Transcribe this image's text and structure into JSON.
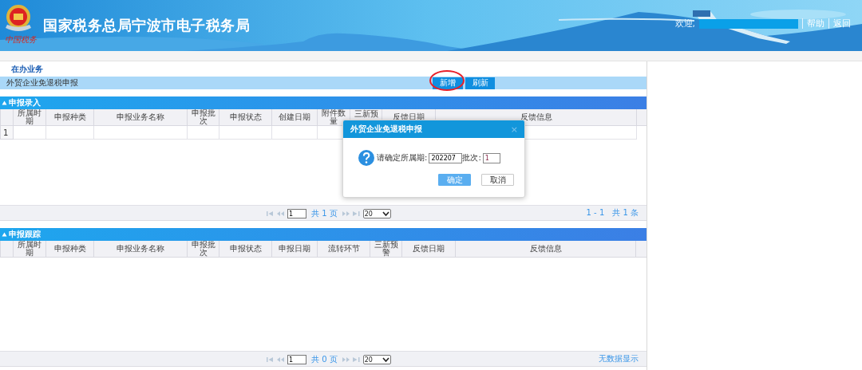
{
  "header": {
    "title": "国家税务总局宁波市电子税务局",
    "logo_caption": "中国税务",
    "welcome": "欢迎,",
    "links": [
      "帮助",
      "返回"
    ]
  },
  "breadcrumb": "在办业务",
  "toolbar": {
    "title": "外贸企业免退税申报",
    "buttons": [
      {
        "label": "新增",
        "highlighted": true
      },
      {
        "label": "刷新",
        "highlighted": false
      }
    ]
  },
  "panels": [
    {
      "title": "申报录入",
      "columns": [
        "所属时期",
        "申报种类",
        "申报业务名称",
        "申报批次",
        "申报状态",
        "创建日期",
        "附件数量",
        "三新预",
        "反馈日期",
        "反馈信息"
      ],
      "rows": [
        {
          "number": "1"
        }
      ],
      "pager": {
        "page": "1",
        "pages": "共 1 页",
        "page_size": "20",
        "summary": "1 - 1　共 1 条"
      }
    },
    {
      "title": "申报跟踪",
      "columns": [
        "所属时期",
        "申报种类",
        "申报业务名称",
        "申报批次",
        "申报状态",
        "申报日期",
        "流转环节",
        "三新预警",
        "反馈日期",
        "反馈信息"
      ],
      "pager": {
        "page": "1",
        "pages": "共 0 页",
        "page_size": "20",
        "summary": "无数据显示"
      }
    }
  ],
  "dialog": {
    "title": "外贸企业免退税申报",
    "close": "×",
    "prompt": "请确定所属期:",
    "period": "202207",
    "batch_label": "批次:",
    "batch": "1",
    "buttons": [
      {
        "label": "确定",
        "kind": "primary"
      },
      {
        "label": "取消",
        "kind": "secondary"
      }
    ]
  }
}
